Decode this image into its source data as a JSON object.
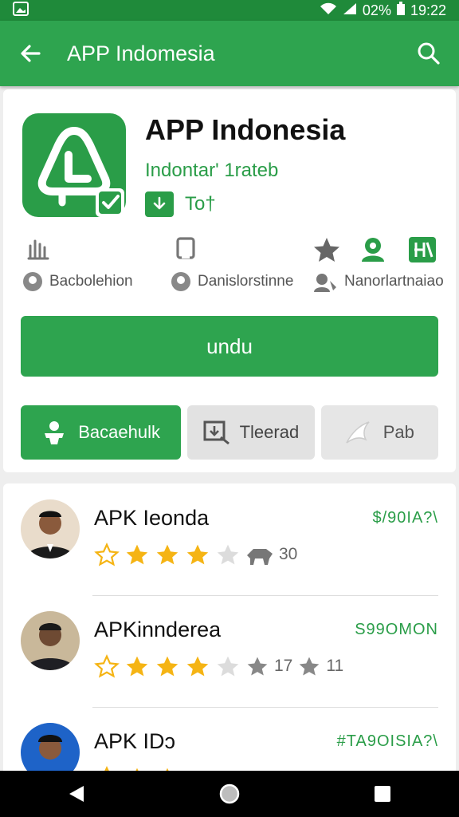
{
  "status_bar": {
    "battery": "02%",
    "time": "19:22"
  },
  "app_bar": {
    "title": "APP Indomesia"
  },
  "app": {
    "name": "APP Indonesia",
    "subtitle": "Indontar' 1rateb",
    "badge_text": "To†",
    "stats": [
      {
        "label": "Bacbolehion"
      },
      {
        "label": "Danislorstinne"
      },
      {
        "label": "Nanorlartnaiao"
      }
    ],
    "install_label": "undu",
    "tabs": [
      {
        "label": "Bacaehulk"
      },
      {
        "label": "Tleerad"
      },
      {
        "label": "Pab"
      }
    ]
  },
  "reviews": [
    {
      "title": "APK Ieonda",
      "link": "$/90IA?\\",
      "rating_text": "30",
      "stars": 3
    },
    {
      "title": "APKinnderea",
      "link": "S99OMON",
      "rating_text_1": "17",
      "rating_text_2": "11",
      "stars": 3
    },
    {
      "title": "APK IDɔ",
      "link": "#TA9OISIA?\\",
      "stars": 3
    }
  ],
  "colors": {
    "primary": "#2ea44f",
    "primary_dark": "#1f8a3a",
    "star": "#f5b414",
    "star_empty": "#dcdcdc"
  }
}
